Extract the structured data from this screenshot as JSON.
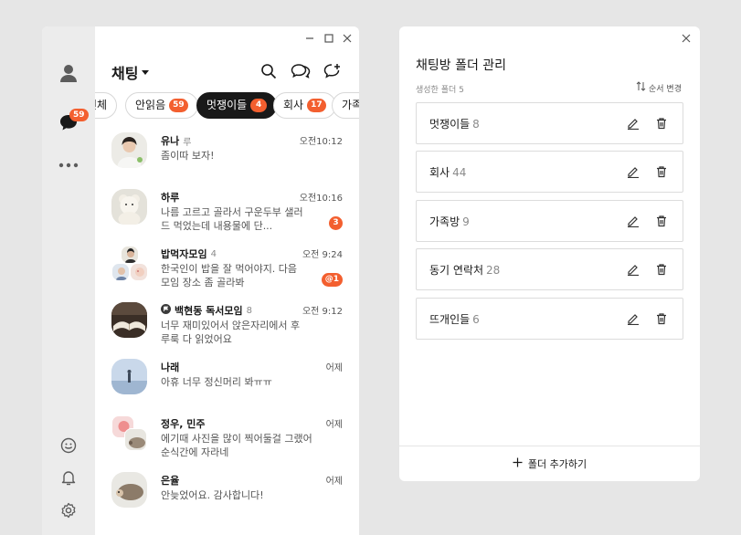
{
  "rail": {
    "chat_badge": "59"
  },
  "chat": {
    "title": "채팅",
    "chips": [
      {
        "label": "전체",
        "count": ""
      },
      {
        "label": "안읽음",
        "count": "59"
      },
      {
        "label": "멋쟁이들",
        "count": "4"
      },
      {
        "label": "회사",
        "count": "17"
      },
      {
        "label": "가족",
        "count": ""
      }
    ],
    "items": [
      {
        "name": "유나",
        "tag": "루",
        "members": "",
        "preview": "좀이따 보자!",
        "time": "오전10:12",
        "badge": ""
      },
      {
        "name": "하루",
        "tag": "",
        "members": "",
        "preview": "나름 고르고 골라서 구운두부 샐러드 먹었는데 내용물에 단...",
        "time": "오전10:16",
        "badge": "3"
      },
      {
        "name": "밥먹자모임",
        "tag": "",
        "members": "4",
        "preview": "한국인이 밥을 잘 먹어야지. 다음 모임 장소 좀 골라봐",
        "time": "오전 9:24",
        "badge": "@1"
      },
      {
        "name": "백현동 독서모임",
        "tag": "",
        "members": "8",
        "preview": "너무 재미있어서 앉은자리에서 후루룩 다 읽었어요",
        "time": "오전 9:12",
        "badge": ""
      },
      {
        "name": "나래",
        "tag": "",
        "members": "",
        "preview": "아휴 너무 정신머리 봐ㅠㅠ",
        "time": "어제",
        "badge": ""
      },
      {
        "name": "정우, 민주",
        "tag": "",
        "members": "",
        "preview": "에기때 사진을 많이 찍어둘걸 그랬어 순식간에 자라네",
        "time": "어제",
        "badge": ""
      },
      {
        "name": "은율",
        "tag": "",
        "members": "",
        "preview": "안늦었어요. 감사합니다!",
        "time": "어제",
        "badge": ""
      }
    ]
  },
  "folders": {
    "title": "채팅방 폴더 관리",
    "subtitle": "생성한 폴더 5",
    "sort_label": "순서 변경",
    "items": [
      {
        "name": "멋쟁이들",
        "count": "8"
      },
      {
        "name": "회사",
        "count": "44"
      },
      {
        "name": "가족방",
        "count": "9"
      },
      {
        "name": "동기 연락처",
        "count": "28"
      },
      {
        "name": "뜨개인들",
        "count": "6"
      }
    ],
    "add_label": "폴더 추가하기"
  },
  "colors": {
    "accent": "#f35f2f",
    "active_chip": "#191919",
    "rail": "#ececec",
    "background": "#e6e6e6"
  }
}
